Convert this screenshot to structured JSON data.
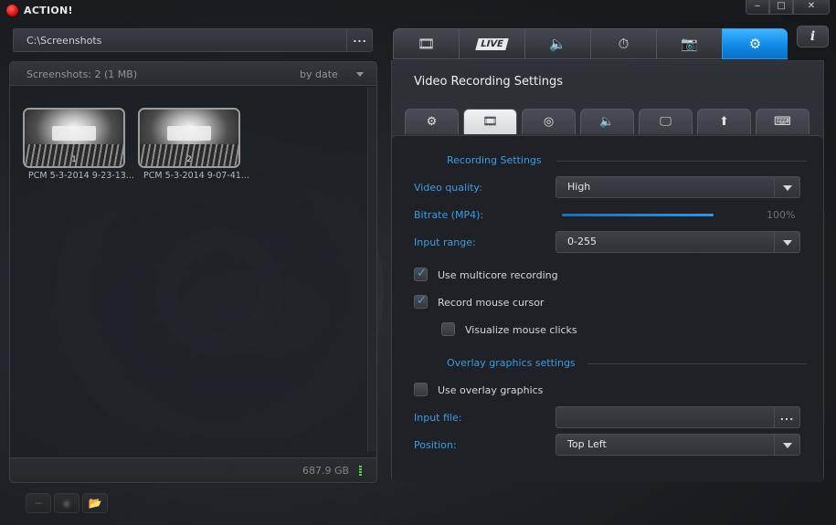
{
  "app": {
    "title": "ACTION!"
  },
  "window": {
    "minimize": "‒",
    "maximize": "□",
    "close": "✕"
  },
  "path": {
    "value": "C:\\Screenshots",
    "browse": "..."
  },
  "gallery": {
    "count_label": "Screenshots: 2 (1 MB)",
    "sort_label": "by date",
    "free_space": "687.9 GB",
    "items": [
      {
        "index": "1",
        "caption": "PCM 5-3-2014 9-23-13..."
      },
      {
        "index": "2",
        "caption": "PCM 5-3-2014 9-07-41..."
      }
    ]
  },
  "bottom_toolbar": {
    "delete": "−",
    "view": "◉",
    "folder": "📂"
  },
  "top_tabs": [
    {
      "name": "video",
      "icon": "film-icon",
      "glyph": "🎞"
    },
    {
      "name": "live",
      "icon": "live-icon",
      "label": "LIVE"
    },
    {
      "name": "audio",
      "icon": "speaker-icon",
      "glyph": "🔈"
    },
    {
      "name": "timer",
      "icon": "stopwatch-icon",
      "glyph": "⏱"
    },
    {
      "name": "screenshot",
      "icon": "camera-icon",
      "glyph": "📷"
    },
    {
      "name": "settings",
      "icon": "gear-icon",
      "glyph": "⚙",
      "active": true
    }
  ],
  "info_button": "i",
  "settings": {
    "title": "Video Recording Settings",
    "sub_tabs": [
      {
        "name": "general",
        "icon": "gear-icon",
        "glyph": "⚙"
      },
      {
        "name": "video",
        "icon": "film-icon",
        "glyph": "🎞",
        "active": true
      },
      {
        "name": "webcam",
        "icon": "webcam-icon",
        "glyph": "◎"
      },
      {
        "name": "audio",
        "icon": "speaker-icon",
        "glyph": "🔈"
      },
      {
        "name": "display",
        "icon": "monitor-icon",
        "glyph": "🖵"
      },
      {
        "name": "upload",
        "icon": "upload-icon",
        "glyph": "⬆"
      },
      {
        "name": "hotkeys",
        "icon": "keyboard-icon",
        "glyph": "⌨"
      }
    ],
    "recording_section": "Recording Settings",
    "video_quality_label": "Video quality:",
    "video_quality_value": "High",
    "bitrate_label": "Bitrate (MP4):",
    "bitrate_value": "100%",
    "bitrate_level": 1.0,
    "input_range_label": "Input range:",
    "input_range_value": "0-255",
    "multicore_label": "Use multicore recording",
    "multicore_checked": true,
    "mouse_cursor_label": "Record mouse cursor",
    "mouse_cursor_checked": true,
    "mouse_clicks_label": "Visualize mouse clicks",
    "mouse_clicks_checked": false,
    "overlay_section": "Overlay graphics settings",
    "overlay_label": "Use overlay graphics",
    "overlay_checked": false,
    "input_file_label": "Input file:",
    "input_file_value": "",
    "input_file_browse": "...",
    "position_label": "Position:",
    "position_value": "Top Left"
  },
  "colors": {
    "accent": "#3c9ce6",
    "active_tab": "#1089e8",
    "logo_red": "#d6141a"
  }
}
